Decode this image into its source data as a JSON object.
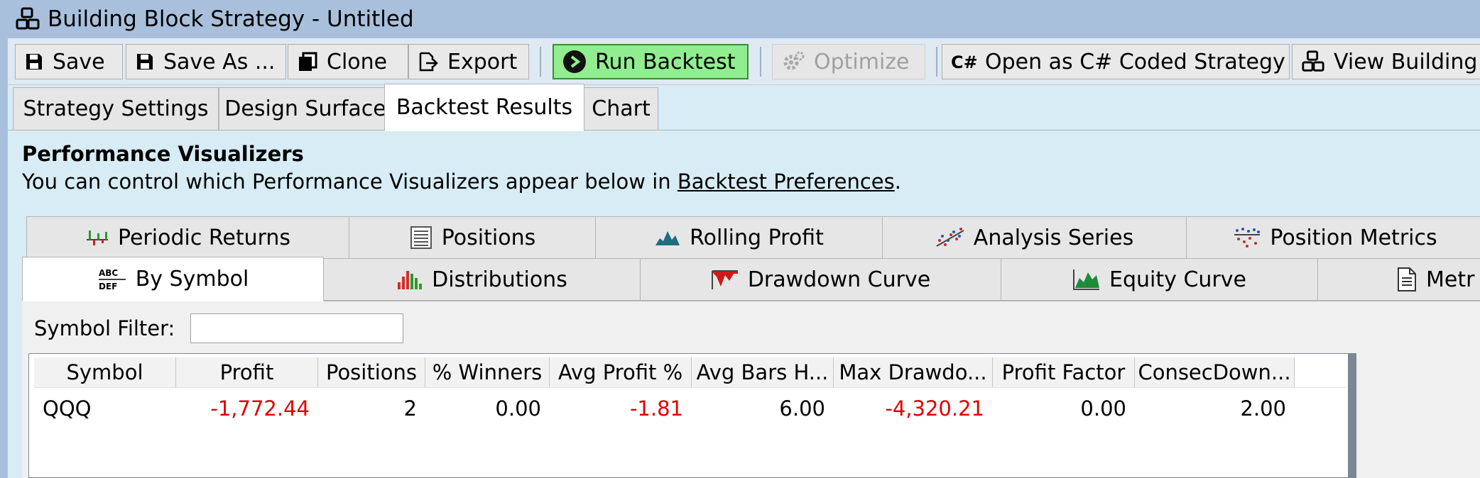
{
  "window": {
    "title": "Building Block Strategy - Untitled"
  },
  "toolbar": {
    "save": "Save",
    "save_as": "Save As ...",
    "clone": "Clone",
    "export": "Export",
    "run_backtest": "Run Backtest",
    "optimize": "Optimize",
    "open_csharp": "Open as C# Coded Strategy",
    "view_building_blocks": "View Building B"
  },
  "main_tabs": [
    "Strategy Settings",
    "Design Surface",
    "Backtest Results",
    "Chart"
  ],
  "main_tab_active": "Backtest Results",
  "perf": {
    "heading": "Performance Visualizers",
    "desc_prefix": "You can control which Performance Visualizers appear below in ",
    "desc_link": "Backtest Preferences",
    "desc_suffix": "."
  },
  "visualizer_tabs_row1": [
    "Periodic Returns",
    "Positions",
    "Rolling Profit",
    "Analysis Series",
    "Position Metrics"
  ],
  "visualizer_tabs_row2": [
    "By Symbol",
    "Distributions",
    "Drawdown Curve",
    "Equity Curve",
    "Metr"
  ],
  "visualizer_active": "By Symbol",
  "filter": {
    "label": "Symbol Filter:",
    "value": ""
  },
  "table": {
    "columns": [
      "Symbol",
      "Profit",
      "Positions",
      "% Winners",
      "Avg Profit %",
      "Avg Bars H...",
      "Max Drawdo...",
      "Profit Factor",
      "ConsecDown..."
    ],
    "rows": [
      [
        "QQQ",
        "-1,772.44",
        "2",
        "0.00",
        "-1.81",
        "6.00",
        "-4,320.21",
        "0.00",
        "2.00"
      ]
    ]
  },
  "colors": {
    "negative": "#e00000",
    "run_button": "#90ee90",
    "background": "#d7ecf4",
    "titlebar": "#a9c0dc"
  }
}
